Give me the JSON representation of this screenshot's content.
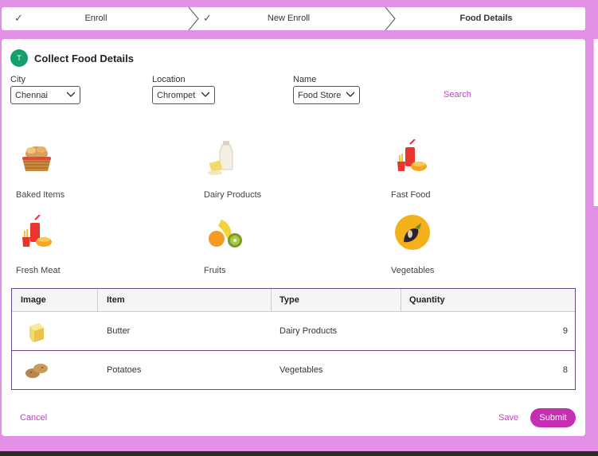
{
  "stepper": {
    "steps": [
      {
        "label": "Enroll",
        "done": true
      },
      {
        "label": "New Enroll",
        "done": true
      },
      {
        "label": "Food Details",
        "done": false,
        "active": true
      }
    ],
    "check_glyph": "✓"
  },
  "header": {
    "avatar_initial": "T",
    "title": "Collect Food Details"
  },
  "filters": {
    "city": {
      "label": "City",
      "value": "Chennai"
    },
    "location": {
      "label": "Location",
      "value": "Chrompet"
    },
    "name": {
      "label": "Name",
      "value": "Food Store"
    },
    "search_label": "Search"
  },
  "categories": [
    {
      "label": "Baked Items",
      "icon": "bread-basket-icon"
    },
    {
      "label": "Dairy Products",
      "icon": "milk-bottle-icon"
    },
    {
      "label": "Fast Food",
      "icon": "fries-soda-icon"
    },
    {
      "label": "Fresh Meat",
      "icon": "fries-soda-icon"
    },
    {
      "label": "Fruits",
      "icon": "fruits-icon"
    },
    {
      "label": "Vegetables",
      "icon": "eggplant-icon"
    }
  ],
  "table": {
    "columns": [
      "Image",
      "Item",
      "Type",
      "Quantity"
    ],
    "rows": [
      {
        "image": "butter-icon",
        "item": "Butter",
        "type": "Dairy Products",
        "quantity": "9"
      },
      {
        "image": "potatoes-icon",
        "item": "Potatoes",
        "type": "Vegetables",
        "quantity": "8"
      }
    ]
  },
  "actions": {
    "cancel": "Cancel",
    "save": "Save",
    "submit": "Submit"
  },
  "colors": {
    "background": "#e190e6",
    "accent": "#c52fb4",
    "avatar": "#14a06b",
    "table_border": "#6b4a82"
  }
}
